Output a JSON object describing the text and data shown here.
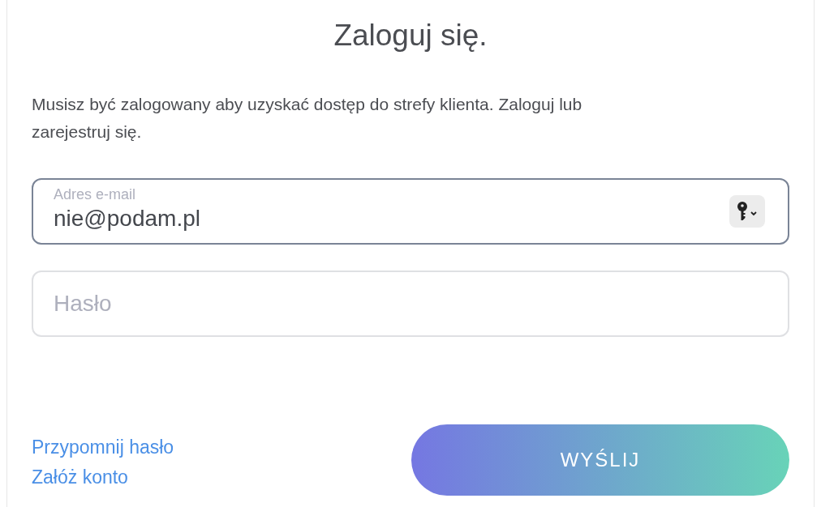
{
  "title": "Zaloguj się.",
  "intro": "Musisz być zalogowany aby uzyskać dostęp do strefy klienta. Zaloguj lub zarejestruj się.",
  "email": {
    "label": "Adres e-mail",
    "value": "nie@podam.pl",
    "focused": true
  },
  "password": {
    "placeholder": "Hasło",
    "focused": false
  },
  "links": [
    "Przypomnij hasło",
    "Załóż konto"
  ],
  "submit": "WYŚLIJ"
}
